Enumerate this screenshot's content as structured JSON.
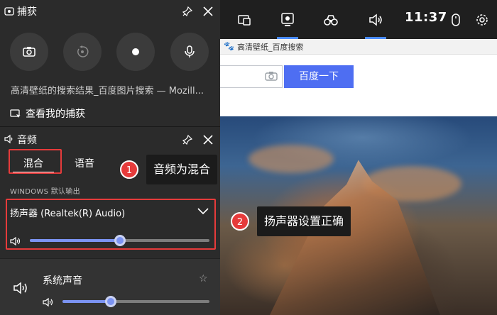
{
  "browser": {
    "tab_title": "高清壁纸_百度搜索",
    "search_button": "百度一下"
  },
  "top_bar": {
    "clock": "11:37",
    "icons": [
      "widget-icon",
      "capture-icon",
      "performance-icon",
      "audio-icon",
      "mouse-icon",
      "settings-icon"
    ]
  },
  "capture_panel": {
    "title": "捕获",
    "buttons": [
      "screenshot-icon",
      "record-last-icon",
      "record-icon",
      "microphone-icon"
    ],
    "capturing_title": "高清壁纸的搜索结果_百度图片搜索 — Mozill...",
    "view_captures": "查看我的捕获"
  },
  "audio_panel": {
    "title": "音频",
    "tabs": [
      {
        "label": "混合",
        "selected": true
      },
      {
        "label": "语音",
        "selected": false
      }
    ],
    "section_label": "WINDOWS 默认输出",
    "device": "扬声器 (Realtek(R) Audio)",
    "device_volume": 0.5,
    "mixer": [
      {
        "name": "系统声音",
        "volume": 0.33
      }
    ]
  },
  "annotations": [
    {
      "number": "1",
      "text": "音频为混合"
    },
    {
      "number": "2",
      "text": "扬声器设置正确"
    }
  ],
  "colors": {
    "accent": "#7b93f2",
    "highlight": "#e63b3b",
    "baidu_blue": "#4e6ef2"
  }
}
